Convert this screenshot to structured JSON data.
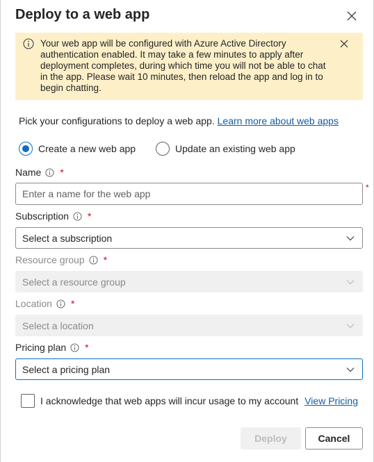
{
  "dialog": {
    "title": "Deploy to a web app",
    "close_icon": "close-icon"
  },
  "banner": {
    "icon": "info-icon",
    "text": "Your web app will be configured with Azure Active Directory authentication enabled. It may take a few minutes to apply after deployment completes, during which time you will not be able to chat in the app. Please wait 10 minutes, then reload the app and log in to begin chatting.",
    "dismiss_icon": "close-icon"
  },
  "intro": {
    "text": "Pick your configurations to deploy a web app.",
    "link": "Learn more about web apps"
  },
  "mode": {
    "options": [
      {
        "label": "Create a new web app",
        "checked": true
      },
      {
        "label": "Update an existing web app",
        "checked": false
      }
    ]
  },
  "fields": {
    "name": {
      "label": "Name",
      "required": "*",
      "placeholder": "Enter a name for the web app"
    },
    "subscription": {
      "label": "Subscription",
      "required": "*",
      "value": "Select a subscription"
    },
    "resource_group": {
      "label": "Resource group",
      "required": "*",
      "value": "Select a resource group",
      "disabled": true
    },
    "location": {
      "label": "Location",
      "required": "*",
      "value": "Select a location",
      "disabled": true
    },
    "pricing_plan": {
      "label": "Pricing plan",
      "required": "*",
      "value": "Select a pricing plan"
    }
  },
  "acknowledge": {
    "label": "I acknowledge that web apps will incur usage to my account",
    "link": "View Pricing",
    "checked": false
  },
  "actions": {
    "deploy": "Deploy",
    "cancel": "Cancel"
  },
  "colors": {
    "accent": "#0f6cbd",
    "banner_bg": "#fdf0c9",
    "required": "#c50f1f",
    "link": "#115ea3"
  }
}
